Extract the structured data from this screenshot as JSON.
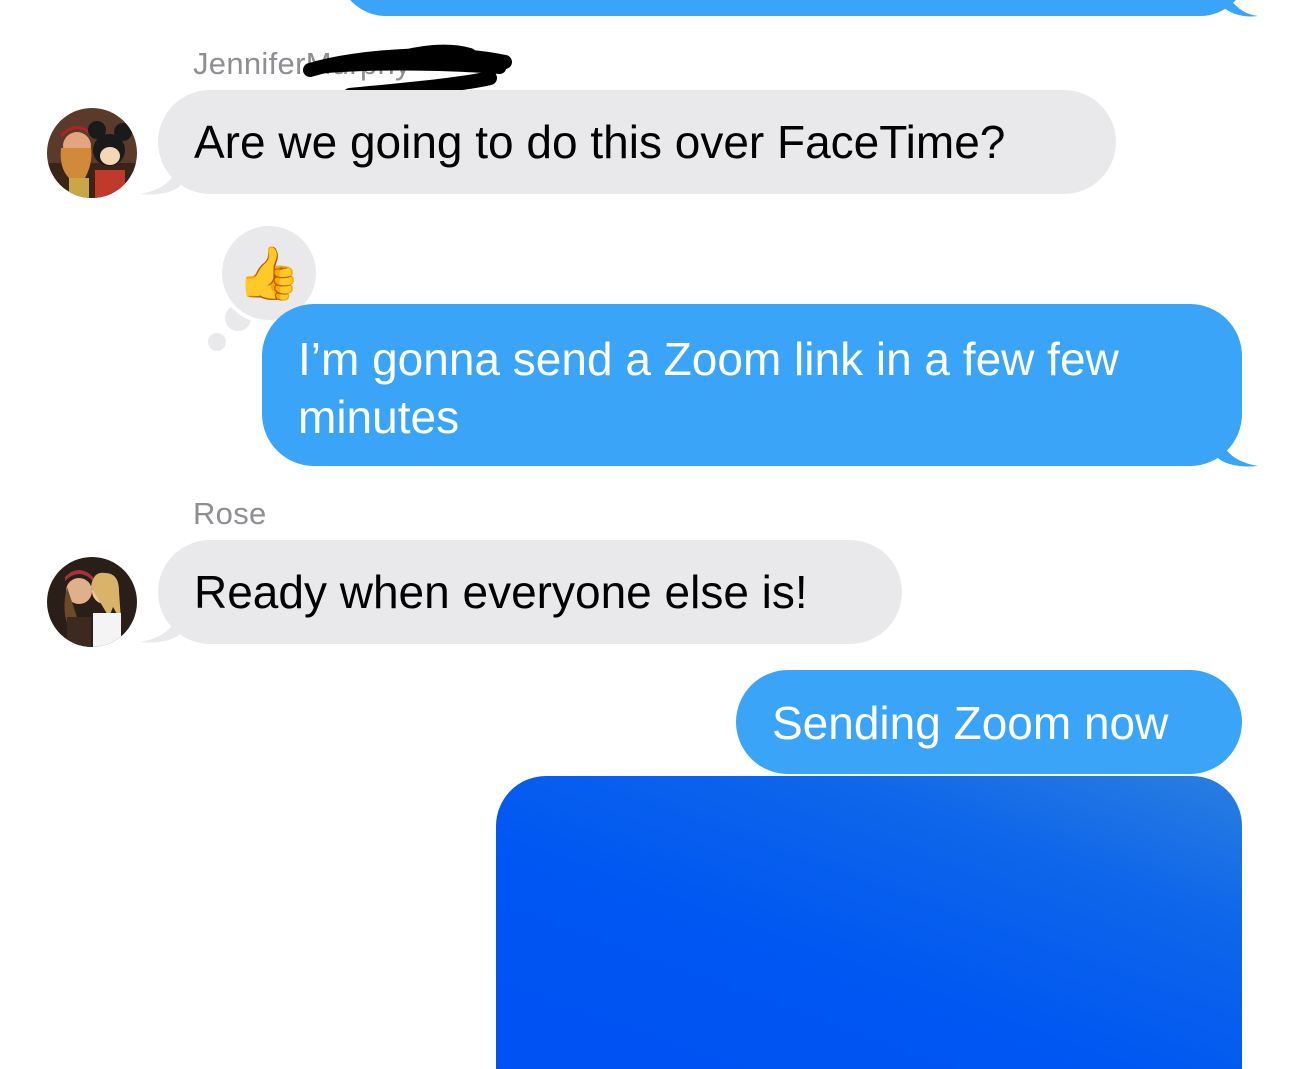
{
  "conversation": {
    "messages": [
      {
        "id": "m1",
        "direction": "outgoing",
        "text": "",
        "partially_visible": true
      },
      {
        "id": "m2",
        "direction": "incoming",
        "sender": "Jennifer",
        "sender_redacted_suffix": "Murphy",
        "text": "Are we going to do this over FaceTime?",
        "avatar_icon": "avatar-photo-icon"
      },
      {
        "id": "m3",
        "direction": "outgoing",
        "text": "I’m gonna send a Zoom link in a few few minutes",
        "tapback": "👍",
        "tapback_icon": "thumbs-up-icon"
      },
      {
        "id": "m4",
        "direction": "incoming",
        "sender": "Rose",
        "text": "Ready when everyone else is!",
        "avatar_icon": "avatar-photo-icon"
      },
      {
        "id": "m5",
        "direction": "outgoing",
        "text": "Sending Zoom now"
      },
      {
        "id": "m6",
        "direction": "outgoing",
        "type": "link-preview",
        "text": ""
      }
    ]
  },
  "colors": {
    "outgoing_bubble": "#3aa5f8",
    "incoming_bubble": "#e9e9eb",
    "sender_name": "#8e8e93",
    "link_preview": "#0057f2"
  }
}
